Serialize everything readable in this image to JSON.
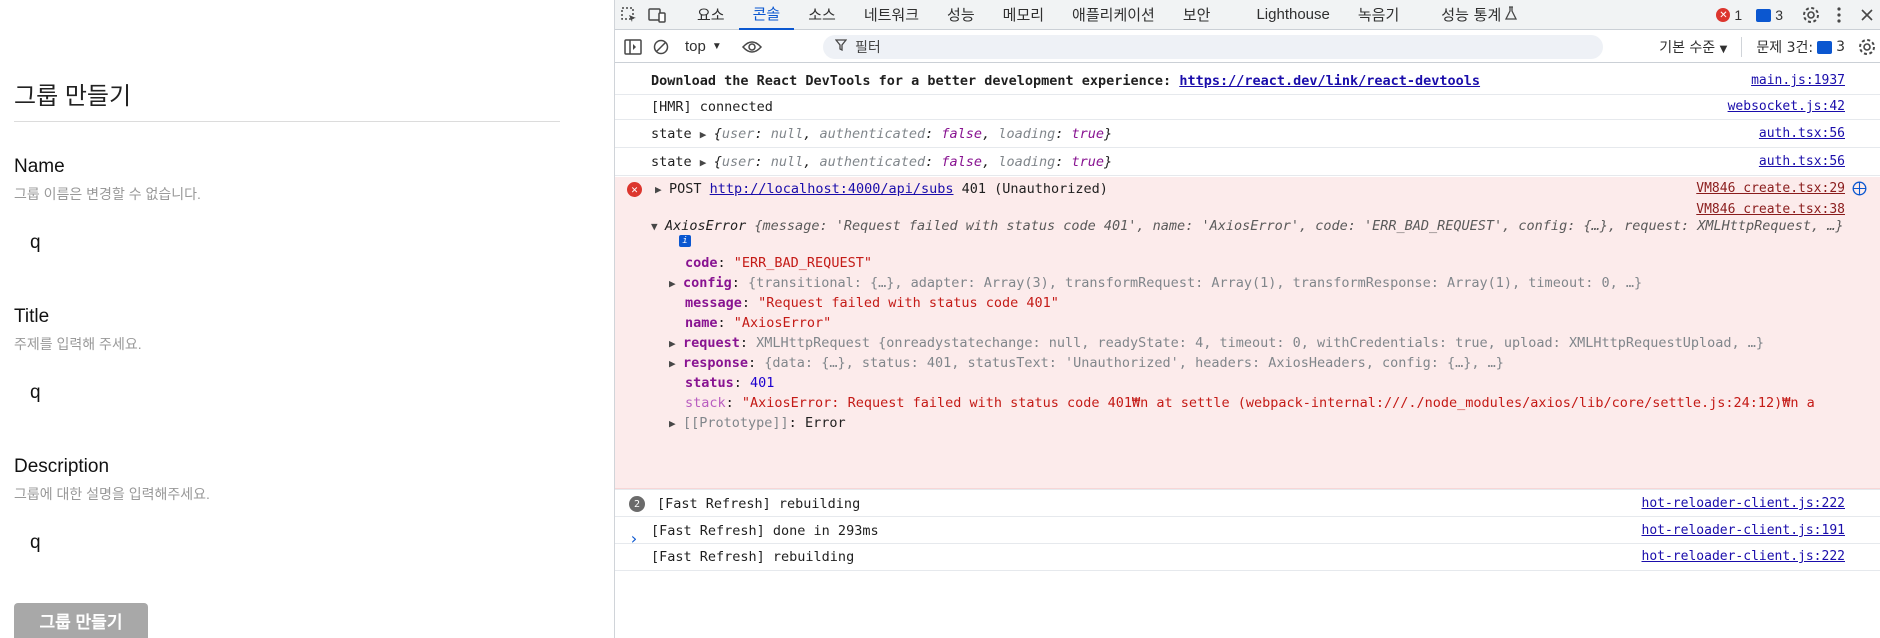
{
  "app": {
    "title": "그룹 만들기",
    "fields": [
      {
        "label": "Name",
        "help": "그룹 이름은 변경할 수 없습니다.",
        "value": "q"
      },
      {
        "label": "Title",
        "help": "주제를 입력해 주세요.",
        "value": "q"
      },
      {
        "label": "Description",
        "help": "그룹에 대한 설명을 입력해주세요.",
        "value": "q"
      }
    ],
    "submit_label": "그룹 만들기"
  },
  "devtools": {
    "tabs": [
      "요소",
      "콘솔",
      "소스",
      "네트워크",
      "성능",
      "메모리",
      "애플리케이션",
      "보안",
      "Lighthouse",
      "녹음기",
      "성능 통계"
    ],
    "active_tab": "콘솔",
    "error_count": "1",
    "message_count": "3",
    "context": "top",
    "filter_placeholder": "필터",
    "log_level": "기본 수준",
    "issues_label": "문제 3건:",
    "issues_count": "3"
  },
  "console": {
    "devtools_msg": "Download the React DevTools for a better development experience: ",
    "devtools_link": "https://react.dev/link/react-devtools",
    "devtools_src": "main.js:1937",
    "hmr_msg": "[HMR] connected",
    "hmr_src": "websocket.js:42",
    "state_label": "state",
    "state_obj_user": "user",
    "state_obj_null": "null",
    "state_obj_auth": "authenticated",
    "state_obj_false": "false",
    "state_obj_loading": "loading",
    "state_obj_true": "true",
    "state_src": "auth.tsx:56",
    "post_method": "POST",
    "post_url": "http://localhost:4000/api/subs",
    "post_status": "401 (Unauthorized)",
    "post_src": "VM846 create.tsx:29",
    "axios_src": "VM846 create.tsx:38",
    "axios_head": "AxiosError",
    "axios_head_rest": "{message: 'Request failed with status code 401', name: 'AxiosError', code: 'ERR_BAD_REQUEST', config: {…}, request: XMLHttpRequest, …}",
    "code_key": "code",
    "code_val": "\"ERR_BAD_REQUEST\"",
    "config_key": "config",
    "config_val": "{transitional: {…}, adapter: Array(3), transformRequest: Array(1), transformResponse: Array(1), timeout: 0, …}",
    "message_key": "message",
    "message_val": "\"Request failed with status code 401\"",
    "name_key": "name",
    "name_val": "\"AxiosError\"",
    "request_key": "request",
    "request_val": "XMLHttpRequest {onreadystatechange: null, readyState: 4, timeout: 0, withCredentials: true, upload: XMLHttpRequestUpload, …}",
    "response_key": "response",
    "response_val": "{data: {…}, status: 401, statusText: 'Unauthorized', headers: AxiosHeaders, config: {…}, …}",
    "status_key": "status",
    "status_val": "401",
    "stack_key": "stack",
    "stack_val": "\"AxiosError: Request failed with status code 401₩n    at settle (webpack-internal:///./node_modules/axios/lib/core/settle.js:24:12)₩n    a",
    "proto_key": "[[Prototype]]",
    "proto_val": "Error",
    "fr_count": "2",
    "fr_rebuilding": "[Fast Refresh] rebuilding",
    "fr_rebuilding_src": "hot-reloader-client.js:222",
    "fr_done": "[Fast Refresh] done in 293ms",
    "fr_done_src": "hot-reloader-client.js:191",
    "fr_rebuilding2": "[Fast Refresh] rebuilding",
    "fr_rebuilding2_src": "hot-reloader-client.js:222",
    "prompt": "›"
  },
  "colors": {
    "accent": "#0b57d0",
    "error": "#dc362e",
    "error_bg": "#fcebeb"
  }
}
